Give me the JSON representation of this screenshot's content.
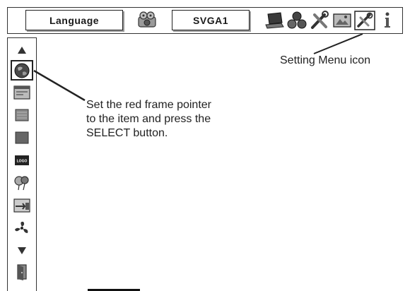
{
  "menubar": {
    "language_label": "Language",
    "resolution_label": "SVGA1",
    "icons": [
      "projector-icon",
      "laptop-icon",
      "people-icon",
      "tools-icon",
      "screen-icon",
      "setting-menu-icon",
      "info-icon"
    ]
  },
  "sidebar": {
    "items": [
      "scroll-up-icon",
      "language-globe-icon",
      "window-icon",
      "keystone-icon",
      "blank-icon",
      "logo-icon",
      "balloon-icon",
      "input-cable-icon",
      "fan-icon",
      "scroll-down-icon",
      "exit-door-icon"
    ],
    "logo_text": "LOGO"
  },
  "annotations": {
    "setting_menu": "Setting Menu icon",
    "select_line1": "Set the red frame pointer",
    "select_line2": "to the item and press the",
    "select_line3": "SELECT button."
  },
  "colors": {
    "border": "#333333",
    "icon_gray": "#6b6b6b",
    "icon_dark": "#2a2a2a"
  }
}
